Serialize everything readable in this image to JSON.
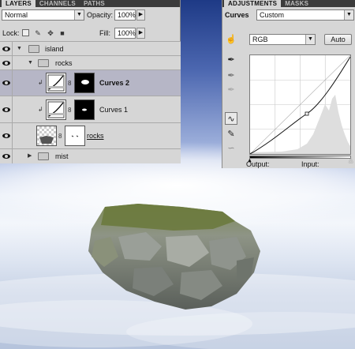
{
  "layers_panel": {
    "tabs": [
      "LAYERS",
      "CHANNELS",
      "PATHS"
    ],
    "blend_mode": "Normal",
    "opacity_label": "Opacity:",
    "opacity_value": "100%",
    "lock_label": "Lock:",
    "fill_label": "Fill:",
    "fill_value": "100%",
    "layers": [
      {
        "name": "island",
        "kind": "group",
        "indent": 0
      },
      {
        "name": "rocks",
        "kind": "group",
        "indent": 1
      },
      {
        "name": "Curves 2",
        "kind": "adjustment",
        "selected": true
      },
      {
        "name": "Curves 1",
        "kind": "adjustment",
        "selected": false
      },
      {
        "name": "rocks",
        "kind": "pixel"
      },
      {
        "name": "mist",
        "kind": "group",
        "indent": 1
      }
    ]
  },
  "adjustments_panel": {
    "tabs": [
      "ADJUSTMENTS",
      "MASKS"
    ],
    "adjustment_type": "Curves",
    "preset_value": "Custom",
    "channel_value": "RGB",
    "auto_label": "Auto",
    "output_label": "Output:",
    "input_label": "Input:",
    "tool_icons": [
      "target-adjust-icon",
      "eyedropper-black-icon",
      "eyedropper-gray-icon",
      "eyedropper-white-icon",
      "curve-edit-icon",
      "pencil-icon",
      "smooth-curve-icon"
    ]
  },
  "colors": {
    "panel_bg": "#d6d6d6",
    "tab_bar_bg": "#3b3b3b",
    "selected_row": "#b6b6c6",
    "sky_top": "#1e3a86"
  }
}
